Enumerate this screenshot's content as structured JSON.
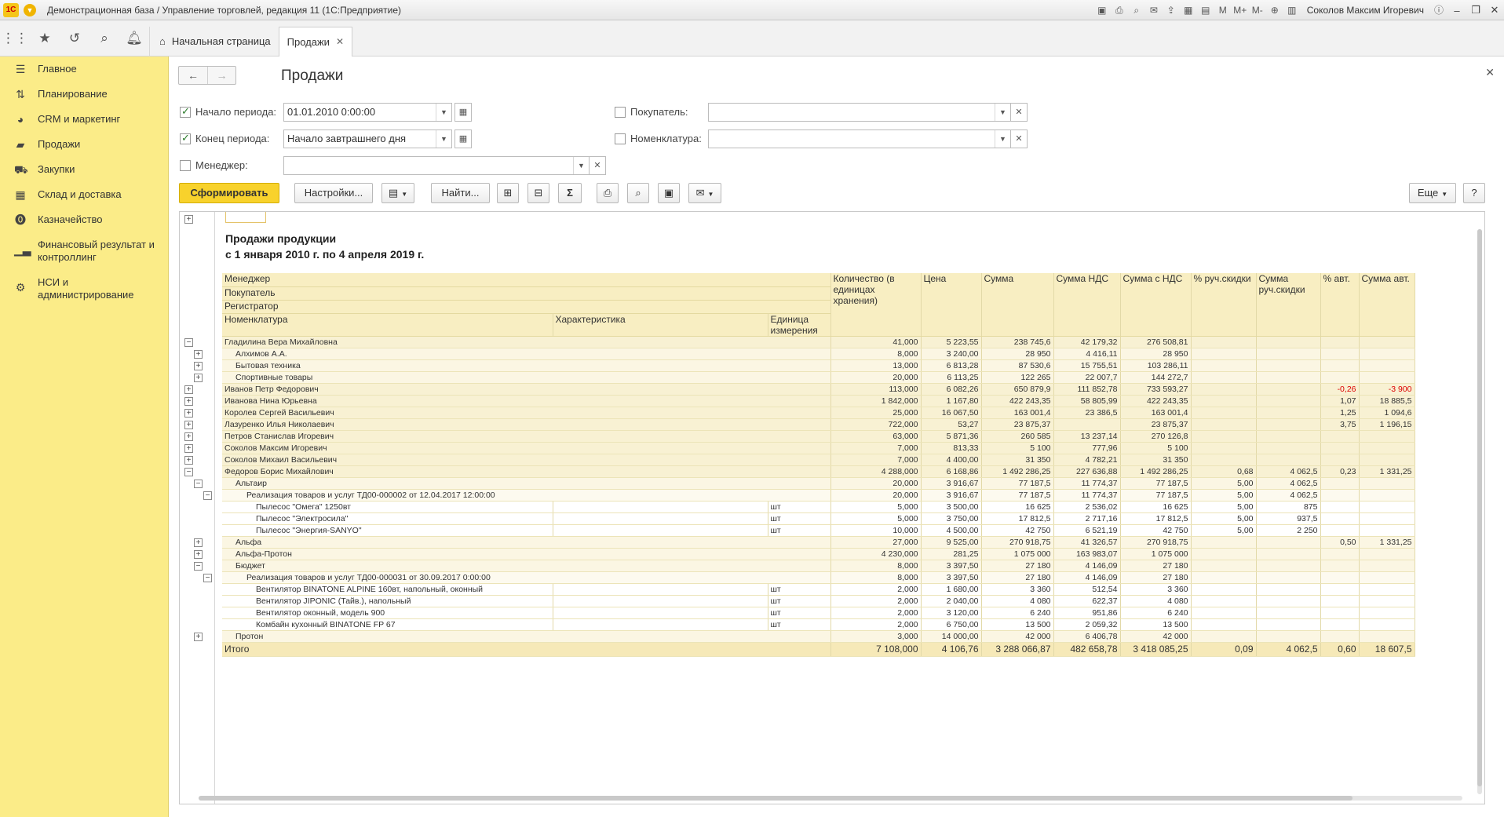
{
  "titlebar": {
    "logo": "1С",
    "title": "Демонстрационная база / Управление торговлей, редакция 11  (1С:Предприятие)",
    "user": "Соколов Максим Игоревич",
    "m_labels": [
      "M",
      "M+",
      "M-"
    ]
  },
  "topnav": {
    "home_tab": "Начальная страница",
    "active_tab": "Продажи"
  },
  "sidebar": {
    "items": [
      {
        "label": "Главное",
        "icon": "menu-icon"
      },
      {
        "label": "Планирование",
        "icon": "planning-icon"
      },
      {
        "label": "CRM и маркетинг",
        "icon": "crm-icon"
      },
      {
        "label": "Продажи",
        "icon": "bag-icon"
      },
      {
        "label": "Закупки",
        "icon": "cart-icon"
      },
      {
        "label": "Склад и доставка",
        "icon": "warehouse-icon"
      },
      {
        "label": "Казначейство",
        "icon": "treasury-icon"
      },
      {
        "label": "Финансовый результат и контроллинг",
        "icon": "chart-icon"
      },
      {
        "label": "НСИ и администрирование",
        "icon": "gear-icon"
      }
    ]
  },
  "form": {
    "title": "Продажи",
    "period_start_label": "Начало периода:",
    "period_start_value": "01.01.2010  0:00:00",
    "period_end_label": "Конец периода:",
    "period_end_value": "Начало завтрашнего дня",
    "manager_label": "Менеджер:",
    "manager_value": "",
    "buyer_label": "Покупатель:",
    "buyer_value": "",
    "nomenclature_label": "Номенклатура:",
    "nomenclature_value": ""
  },
  "toolbar": {
    "generate": "Сформировать",
    "settings": "Настройки...",
    "find": "Найти...",
    "more": "Еще",
    "help": "?"
  },
  "report": {
    "title": "Продажи продукции",
    "subtitle": "с 1 января 2010 г. по 4 апреля 2019 г.",
    "headers": {
      "manager": "Менеджер",
      "buyer": "Покупатель",
      "registrar": "Регистратор",
      "nomenclature": "Номенклатура",
      "characteristic": "Характеристика",
      "unit": "Единица измерения",
      "qty": "Количество (в единицах хранения)",
      "price": "Цена",
      "sum": "Сумма",
      "vat": "Сумма НДС",
      "sum_vat": "Сумма с НДС",
      "disc_pct": "% руч.скидки",
      "disc_sum": "Сумма руч.скидки",
      "auto_pct": "% авт.",
      "auto_sum": "Сумма авт."
    },
    "rows": [
      {
        "level": 0,
        "ctl": "−",
        "name": "Гладилина Вера Михайловна",
        "unit": "",
        "qty": "41,000",
        "price": "5 223,55",
        "sum": "238 745,6",
        "vat": "42 179,32",
        "sum_vat": "276 508,81",
        "disc_pct": "",
        "disc_sum": "",
        "auto_pct": "",
        "auto_sum": ""
      },
      {
        "level": 1,
        "ctl": "+",
        "name": "Алхимов А.А.",
        "unit": "",
        "qty": "8,000",
        "price": "3 240,00",
        "sum": "28 950",
        "vat": "4 416,11",
        "sum_vat": "28 950",
        "disc_pct": "",
        "disc_sum": "",
        "auto_pct": "",
        "auto_sum": ""
      },
      {
        "level": 1,
        "ctl": "+",
        "name": "Бытовая техника",
        "unit": "",
        "qty": "13,000",
        "price": "6 813,28",
        "sum": "87 530,6",
        "vat": "15 755,51",
        "sum_vat": "103 286,11",
        "disc_pct": "",
        "disc_sum": "",
        "auto_pct": "",
        "auto_sum": ""
      },
      {
        "level": 1,
        "ctl": "+",
        "name": "Спортивные товары",
        "unit": "",
        "qty": "20,000",
        "price": "6 113,25",
        "sum": "122 265",
        "vat": "22 007,7",
        "sum_vat": "144 272,7",
        "disc_pct": "",
        "disc_sum": "",
        "auto_pct": "",
        "auto_sum": ""
      },
      {
        "level": 0,
        "ctl": "+",
        "name": "Иванов Петр Федорович",
        "unit": "",
        "qty": "113,000",
        "price": "6 082,26",
        "sum": "650 879,9",
        "vat": "111 852,78",
        "sum_vat": "733 593,27",
        "disc_pct": "",
        "disc_sum": "",
        "auto_pct": "-0,26",
        "auto_sum": "-3 900"
      },
      {
        "level": 0,
        "ctl": "+",
        "name": "Иванова Нина Юрьевна",
        "unit": "",
        "qty": "1 842,000",
        "price": "1 167,80",
        "sum": "422 243,35",
        "vat": "58 805,99",
        "sum_vat": "422 243,35",
        "disc_pct": "",
        "disc_sum": "",
        "auto_pct": "1,07",
        "auto_sum": "18 885,5"
      },
      {
        "level": 0,
        "ctl": "+",
        "name": "Королев Сергей Васильевич",
        "unit": "",
        "qty": "25,000",
        "price": "16 067,50",
        "sum": "163 001,4",
        "vat": "23 386,5",
        "sum_vat": "163 001,4",
        "disc_pct": "",
        "disc_sum": "",
        "auto_pct": "1,25",
        "auto_sum": "1 094,6"
      },
      {
        "level": 0,
        "ctl": "+",
        "name": "Лазуренко Илья Николаевич",
        "unit": "",
        "qty": "722,000",
        "price": "53,27",
        "sum": "23 875,37",
        "vat": "",
        "sum_vat": "23 875,37",
        "disc_pct": "",
        "disc_sum": "",
        "auto_pct": "3,75",
        "auto_sum": "1 196,15"
      },
      {
        "level": 0,
        "ctl": "+",
        "name": "Петров Станислав Игоревич",
        "unit": "",
        "qty": "63,000",
        "price": "5 871,36",
        "sum": "260 585",
        "vat": "13 237,14",
        "sum_vat": "270 126,8",
        "disc_pct": "",
        "disc_sum": "",
        "auto_pct": "",
        "auto_sum": ""
      },
      {
        "level": 0,
        "ctl": "+",
        "name": "Соколов Максим Игоревич",
        "unit": "",
        "qty": "7,000",
        "price": "813,33",
        "sum": "5 100",
        "vat": "777,96",
        "sum_vat": "5 100",
        "disc_pct": "",
        "disc_sum": "",
        "auto_pct": "",
        "auto_sum": ""
      },
      {
        "level": 0,
        "ctl": "+",
        "name": "Соколов Михаил Васильевич",
        "unit": "",
        "qty": "7,000",
        "price": "4 400,00",
        "sum": "31 350",
        "vat": "4 782,21",
        "sum_vat": "31 350",
        "disc_pct": "",
        "disc_sum": "",
        "auto_pct": "",
        "auto_sum": ""
      },
      {
        "level": 0,
        "ctl": "−",
        "name": "Федоров Борис Михайлович",
        "unit": "",
        "qty": "4 288,000",
        "price": "6 168,86",
        "sum": "1 492 286,25",
        "vat": "227 636,88",
        "sum_vat": "1 492 286,25",
        "disc_pct": "0,68",
        "disc_sum": "4 062,5",
        "auto_pct": "0,23",
        "auto_sum": "1 331,25"
      },
      {
        "level": 1,
        "ctl": "−",
        "name": "Альтаир",
        "unit": "",
        "qty": "20,000",
        "price": "3 916,67",
        "sum": "77 187,5",
        "vat": "11 774,37",
        "sum_vat": "77 187,5",
        "disc_pct": "5,00",
        "disc_sum": "4 062,5",
        "auto_pct": "",
        "auto_sum": ""
      },
      {
        "level": 2,
        "ctl": "−",
        "name": "Реализация товаров и услуг ТД00-000002 от 12.04.2017 12:00:00",
        "unit": "",
        "qty": "20,000",
        "price": "3 916,67",
        "sum": "77 187,5",
        "vat": "11 774,37",
        "sum_vat": "77 187,5",
        "disc_pct": "5,00",
        "disc_sum": "4 062,5",
        "auto_pct": "",
        "auto_sum": ""
      },
      {
        "level": 3,
        "ctl": "",
        "name": "Пылесос \"Омега\" 1250вт",
        "unit": "шт",
        "qty": "5,000",
        "price": "3 500,00",
        "sum": "16 625",
        "vat": "2 536,02",
        "sum_vat": "16 625",
        "disc_pct": "5,00",
        "disc_sum": "875",
        "auto_pct": "",
        "auto_sum": ""
      },
      {
        "level": 3,
        "ctl": "",
        "name": "Пылесос \"Электросила\"",
        "unit": "шт",
        "qty": "5,000",
        "price": "3 750,00",
        "sum": "17 812,5",
        "vat": "2 717,16",
        "sum_vat": "17 812,5",
        "disc_pct": "5,00",
        "disc_sum": "937,5",
        "auto_pct": "",
        "auto_sum": ""
      },
      {
        "level": 3,
        "ctl": "",
        "name": "Пылесос \"Энергия-SANYO\"",
        "unit": "шт",
        "qty": "10,000",
        "price": "4 500,00",
        "sum": "42 750",
        "vat": "6 521,19",
        "sum_vat": "42 750",
        "disc_pct": "5,00",
        "disc_sum": "2 250",
        "auto_pct": "",
        "auto_sum": ""
      },
      {
        "level": 1,
        "ctl": "+",
        "name": "Альфа",
        "unit": "",
        "qty": "27,000",
        "price": "9 525,00",
        "sum": "270 918,75",
        "vat": "41 326,57",
        "sum_vat": "270 918,75",
        "disc_pct": "",
        "disc_sum": "",
        "auto_pct": "0,50",
        "auto_sum": "1 331,25"
      },
      {
        "level": 1,
        "ctl": "+",
        "name": "Альфа-Протон",
        "unit": "",
        "qty": "4 230,000",
        "price": "281,25",
        "sum": "1 075 000",
        "vat": "163 983,07",
        "sum_vat": "1 075 000",
        "disc_pct": "",
        "disc_sum": "",
        "auto_pct": "",
        "auto_sum": ""
      },
      {
        "level": 1,
        "ctl": "−",
        "name": "Бюджет",
        "unit": "",
        "qty": "8,000",
        "price": "3 397,50",
        "sum": "27 180",
        "vat": "4 146,09",
        "sum_vat": "27 180",
        "disc_pct": "",
        "disc_sum": "",
        "auto_pct": "",
        "auto_sum": ""
      },
      {
        "level": 2,
        "ctl": "−",
        "name": "Реализация товаров и услуг ТД00-000031 от 30.09.2017 0:00:00",
        "unit": "",
        "qty": "8,000",
        "price": "3 397,50",
        "sum": "27 180",
        "vat": "4 146,09",
        "sum_vat": "27 180",
        "disc_pct": "",
        "disc_sum": "",
        "auto_pct": "",
        "auto_sum": ""
      },
      {
        "level": 3,
        "ctl": "",
        "name": "Вентилятор BINATONE ALPINE 160вт, напольный, оконный",
        "unit": "шт",
        "qty": "2,000",
        "price": "1 680,00",
        "sum": "3 360",
        "vat": "512,54",
        "sum_vat": "3 360",
        "disc_pct": "",
        "disc_sum": "",
        "auto_pct": "",
        "auto_sum": ""
      },
      {
        "level": 3,
        "ctl": "",
        "name": "Вентилятор JIPONIC (Тайв.), напольный",
        "unit": "шт",
        "qty": "2,000",
        "price": "2 040,00",
        "sum": "4 080",
        "vat": "622,37",
        "sum_vat": "4 080",
        "disc_pct": "",
        "disc_sum": "",
        "auto_pct": "",
        "auto_sum": ""
      },
      {
        "level": 3,
        "ctl": "",
        "name": "Вентилятор оконный, модель 900",
        "unit": "шт",
        "qty": "2,000",
        "price": "3 120,00",
        "sum": "6 240",
        "vat": "951,86",
        "sum_vat": "6 240",
        "disc_pct": "",
        "disc_sum": "",
        "auto_pct": "",
        "auto_sum": ""
      },
      {
        "level": 3,
        "ctl": "",
        "name": "Комбайн кухонный BINATONE FP 67",
        "unit": "шт",
        "qty": "2,000",
        "price": "6 750,00",
        "sum": "13 500",
        "vat": "2 059,32",
        "sum_vat": "13 500",
        "disc_pct": "",
        "disc_sum": "",
        "auto_pct": "",
        "auto_sum": ""
      },
      {
        "level": 1,
        "ctl": "+",
        "name": "Протон",
        "unit": "",
        "qty": "3,000",
        "price": "14 000,00",
        "sum": "42 000",
        "vat": "6 406,78",
        "sum_vat": "42 000",
        "disc_pct": "",
        "disc_sum": "",
        "auto_pct": "",
        "auto_sum": ""
      }
    ],
    "total": {
      "label": "Итого",
      "qty": "7 108,000",
      "price": "4 106,76",
      "sum": "3 288 066,87",
      "vat": "482 658,78",
      "sum_vat": "3 418 085,25",
      "disc_pct": "0,09",
      "disc_sum": "4 062,5",
      "auto_pct": "0,60",
      "auto_sum": "18 607,5"
    }
  }
}
